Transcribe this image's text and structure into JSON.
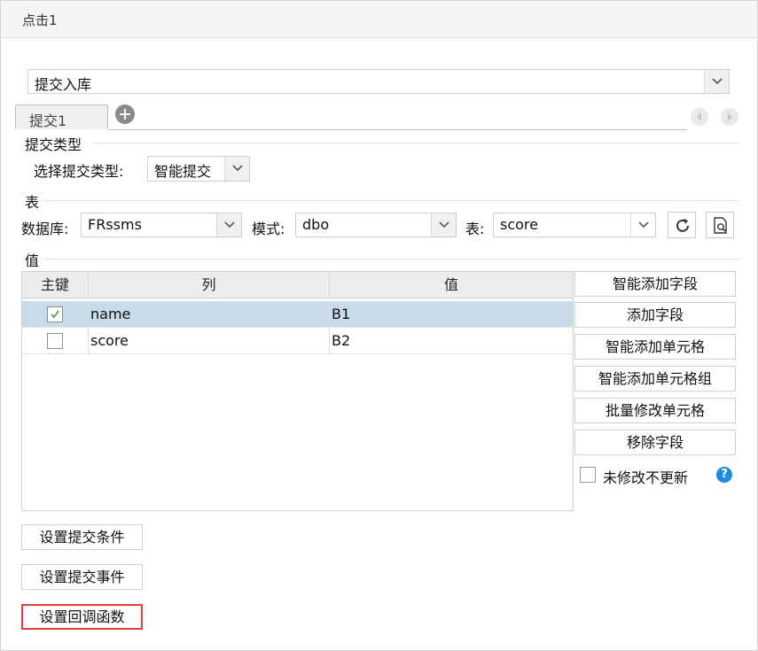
{
  "window": {
    "title": "点击1"
  },
  "submit_type_select": {
    "value": "提交入库"
  },
  "tabs": [
    {
      "label": "提交1"
    }
  ],
  "icons": {
    "add": "plus-circle-icon",
    "prev": "chevron-left-icon",
    "next": "chevron-right-icon",
    "refresh": "refresh-icon",
    "preview": "search-document-icon",
    "help": "question-icon"
  },
  "section_submit_type": {
    "title": "提交类型",
    "select_label": "选择提交类型:",
    "select_value": "智能提交"
  },
  "section_table": {
    "title": "表",
    "database_label": "数据库:",
    "database_value": "FRssms",
    "schema_label": "模式:",
    "schema_value": "dbo",
    "table_label": "表:",
    "table_value": "score"
  },
  "section_value": {
    "title": "值",
    "columns": [
      "主键",
      "列",
      "值"
    ],
    "rows": [
      {
        "key": true,
        "column": "name",
        "value": "B1",
        "selected": true
      },
      {
        "key": false,
        "column": "score",
        "value": "B2",
        "selected": false
      }
    ]
  },
  "actions": {
    "smart_add_field": "智能添加字段",
    "add_field": "添加字段",
    "smart_add_cell": "智能添加单元格",
    "smart_add_cell_group": "智能添加单元格组",
    "batch_modify_cell": "批量修改单元格",
    "remove_field": "移除字段",
    "no_update_unmodified": "未修改不更新",
    "help_symbol": "?"
  },
  "bottom_buttons": {
    "set_submit_condition": "设置提交条件",
    "set_submit_event": "设置提交事件",
    "set_callback_function": "设置回调函数"
  },
  "colors": {
    "selected_row": "#c8dbe8",
    "highlight_border": "#e0403c",
    "help_icon": "#1f8ae0"
  }
}
